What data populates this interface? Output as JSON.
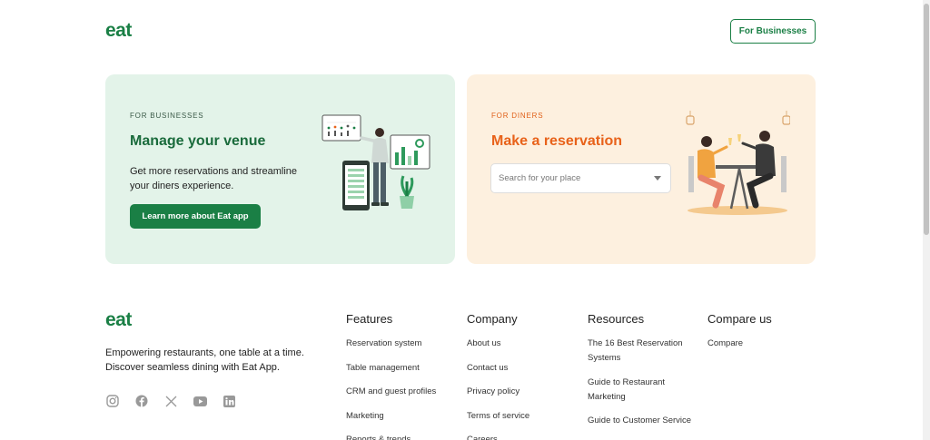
{
  "header": {
    "logo": "eat",
    "for_businesses_label": "For Businesses"
  },
  "business_card": {
    "eyebrow": "FOR BUSINESSES",
    "title": "Manage your venue",
    "description": "Get more reservations and streamline your diners experience.",
    "cta_label": "Learn more about Eat app"
  },
  "diners_card": {
    "eyebrow": "FOR DINERS",
    "title": "Make a reservation",
    "search_placeholder": "Search for your place"
  },
  "footer": {
    "logo": "eat",
    "tagline": "Empowering restaurants, one table at a time. Discover seamless dining with Eat App.",
    "socials": [
      "instagram-icon",
      "facebook-icon",
      "x-icon",
      "youtube-icon",
      "linkedin-icon"
    ],
    "columns": [
      {
        "title": "Features",
        "items": [
          "Reservation system",
          "Table management",
          "CRM and guest profiles",
          "Marketing",
          "Reports & trends"
        ]
      },
      {
        "title": "Company",
        "items": [
          "About us",
          "Contact us",
          "Privacy policy",
          "Terms of service",
          "Careers"
        ]
      },
      {
        "title": "Resources",
        "items": [
          "The 16 Best Reservation Systems",
          "Guide to Restaurant Marketing",
          "Guide to Customer Service"
        ]
      },
      {
        "title": "Compare us",
        "items": [
          "Compare"
        ]
      }
    ]
  },
  "colors": {
    "brand_green": "#1a7f45",
    "business_bg": "#e3f3e9",
    "diners_bg": "#fdf0df",
    "diners_accent": "#e8621a"
  }
}
